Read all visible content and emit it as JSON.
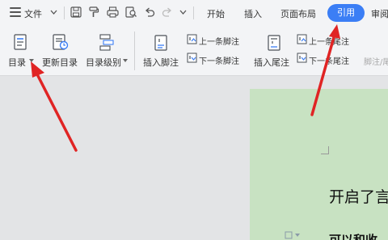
{
  "topbar": {
    "file_label": "文件",
    "tabs": [
      "开始",
      "插入",
      "页面布局",
      "引用",
      "审阅"
    ],
    "active_tab": "引用"
  },
  "ribbon": {
    "toc_label": "目录",
    "update_toc_label": "更新目录",
    "toc_level_label": "目录级别",
    "insert_footnote_label": "插入脚注",
    "prev_footnote_label": "上一条脚注",
    "next_footnote_label": "下一条脚注",
    "insert_endnote_label": "插入尾注",
    "prev_endnote_label": "上一条尾注",
    "next_endnote_label": "下一条尾注",
    "footnote_endnote_cut_label": "脚注/尾"
  },
  "document": {
    "heading1": "开启了言",
    "heading2": "可以和收"
  },
  "colors": {
    "accent": "#3b7ef5",
    "arrow": "#e02424",
    "page": "#c8e2c2"
  }
}
